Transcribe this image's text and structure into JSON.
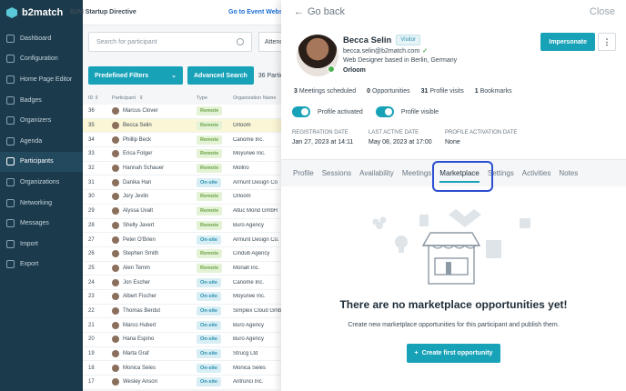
{
  "brand": {
    "name": "b2match"
  },
  "sidebar": {
    "items": [
      {
        "label": "Dashboard",
        "icon": "dashboard-icon"
      },
      {
        "label": "Configuration",
        "icon": "gear-icon"
      },
      {
        "label": "Home Page Editor",
        "icon": "home-icon"
      },
      {
        "label": "Badges",
        "icon": "badge-icon"
      },
      {
        "label": "Organizers",
        "icon": "organizers-icon"
      },
      {
        "label": "Agenda",
        "icon": "calendar-icon"
      },
      {
        "label": "Participants",
        "icon": "participants-icon",
        "active": true
      },
      {
        "label": "Organizations",
        "icon": "building-icon"
      },
      {
        "label": "Networking",
        "icon": "network-icon"
      },
      {
        "label": "Messages",
        "icon": "mail-icon"
      },
      {
        "label": "Import",
        "icon": "import-icon"
      },
      {
        "label": "Export",
        "icon": "export-icon"
      }
    ]
  },
  "topbar": {
    "directive": "B2M Startup Directive",
    "event_link": "Go to Event Websi"
  },
  "list": {
    "search_placeholder": "Search for participant",
    "attendance_label": "Attenc",
    "predefined_filters": "Predefined Filters",
    "advanced_search": "Advanced Search",
    "count": "36 Partic",
    "columns": {
      "id": "ID",
      "participant": "Participant",
      "type": "Type",
      "org": "Organization Name"
    },
    "rows": [
      {
        "id": "36",
        "name": "Marcus Clover",
        "type": "Remote",
        "org": ""
      },
      {
        "id": "35",
        "name": "Becca Selin",
        "type": "Remote",
        "org": "Orloom",
        "highlight": true
      },
      {
        "id": "34",
        "name": "Phillip Beck",
        "type": "Remote",
        "org": "Canome Inc."
      },
      {
        "id": "33",
        "name": "Erica Folger",
        "type": "Remote",
        "org": "Moyurwe Inc."
      },
      {
        "id": "32",
        "name": "Hannah Schauer",
        "type": "Remote",
        "org": "Mollno"
      },
      {
        "id": "31",
        "name": "Danika Han",
        "type": "On-site",
        "org": "Armunt Design Co"
      },
      {
        "id": "30",
        "name": "Jory Jevlin",
        "type": "Remote",
        "org": "Orloom"
      },
      {
        "id": "29",
        "name": "Alyssa Uvalt",
        "type": "Remote",
        "org": "Altuc Mond GmbH"
      },
      {
        "id": "28",
        "name": "Shelly Javert",
        "type": "Remote",
        "org": "Buro Agency"
      },
      {
        "id": "27",
        "name": "Peter O'Brien",
        "type": "On-site",
        "org": "Armunt Design Co."
      },
      {
        "id": "26",
        "name": "Stephen Smith",
        "type": "Remote",
        "org": "Cindub Agency"
      },
      {
        "id": "25",
        "name": "Alen Temm",
        "type": "Remote",
        "org": "Monalt Inc."
      },
      {
        "id": "24",
        "name": "Jon Escher",
        "type": "On-site",
        "org": "Canome Inc."
      },
      {
        "id": "23",
        "name": "Albert Fischer",
        "type": "On-site",
        "org": "Moyurwe Inc."
      },
      {
        "id": "22",
        "name": "Thomas Berdut",
        "type": "On-site",
        "org": "Simplex Cloud GmbH"
      },
      {
        "id": "21",
        "name": "Marco Hubert",
        "type": "On-site",
        "org": "Buro Agency"
      },
      {
        "id": "20",
        "name": "Hana Espino",
        "type": "On-site",
        "org": "Buro Agency"
      },
      {
        "id": "19",
        "name": "Marta Graf",
        "type": "On-site",
        "org": "Strucg Ltd"
      },
      {
        "id": "18",
        "name": "Monica Seles",
        "type": "On-site",
        "org": "Monica Seles"
      },
      {
        "id": "17",
        "name": "Wesley Anson",
        "type": "On-site",
        "org": "Antrunci Inc."
      }
    ]
  },
  "panel": {
    "go_back": "Go back",
    "close": "Close",
    "name": "Becca Selin",
    "role_badge": "Visitor",
    "email": "becca.selin@b2match.com",
    "title": "Web Designer based in Berlin, Germany",
    "company": "Orloom",
    "impersonate": "Impersonate",
    "more": "⋮",
    "stats": [
      {
        "value": "3",
        "label": "Meetings scheduled"
      },
      {
        "value": "0",
        "label": "Opportunities"
      },
      {
        "value": "31",
        "label": "Profile visits"
      },
      {
        "value": "1",
        "label": "Bookmarks"
      }
    ],
    "toggles": {
      "activated": "Profile activated",
      "visible": "Profile visible"
    },
    "dates": [
      {
        "label": "REGISTRATION DATE",
        "value": "Jan 27, 2023 at 14:11"
      },
      {
        "label": "LAST ACTIVE DATE",
        "value": "May 08, 2023 at 17:00"
      },
      {
        "label": "PROFILE ACTIVATION DATE",
        "value": "None"
      }
    ],
    "tabs": [
      "Profile",
      "Sessions",
      "Availability",
      "Meetings",
      "Marketplace",
      "Settings",
      "Activities",
      "Notes"
    ],
    "active_tab": "Marketplace",
    "empty_title": "There are no marketplace opportunities yet!",
    "empty_sub": "Create new marketplace opportunities for this participant and publish them.",
    "create_button": "Create first opportunity"
  },
  "colors": {
    "sidebar": "#1b3a4b",
    "accent": "#17a2b8",
    "highlight_box": "#2b4fd0"
  }
}
